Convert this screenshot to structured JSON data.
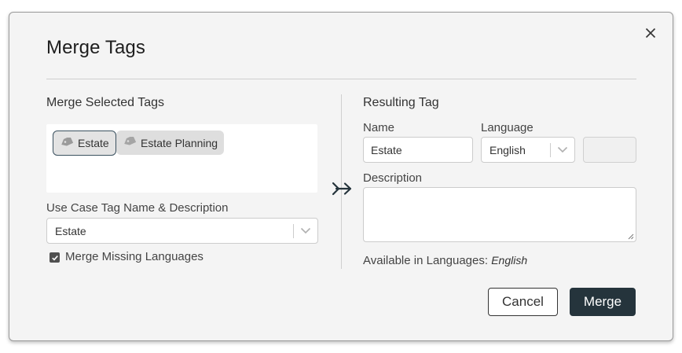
{
  "dialog": {
    "title": "Merge Tags",
    "close_icon": "close-icon"
  },
  "left": {
    "section_title": "Merge Selected Tags",
    "tags": [
      {
        "label": "Estate",
        "selected": true,
        "icon": "tag-icon"
      },
      {
        "label": "Estate Planning",
        "selected": false,
        "icon": "tag-icon"
      }
    ],
    "use_case_label": "Use Case Tag Name & Description",
    "use_case_value": "Estate",
    "merge_missing_label": "Merge Missing Languages",
    "merge_missing_checked": true
  },
  "right": {
    "section_title": "Resulting Tag",
    "name_label": "Name",
    "name_value": "Estate",
    "language_label": "Language",
    "language_value": "English",
    "description_label": "Description",
    "description_value": "",
    "available_label": "Available in Languages:",
    "available_value": "English"
  },
  "buttons": {
    "cancel": "Cancel",
    "merge": "Merge"
  },
  "colors": {
    "primary_button": "#25343c",
    "dialog_bg": "#f4f4f4"
  }
}
